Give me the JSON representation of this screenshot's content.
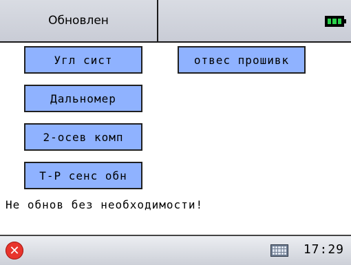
{
  "header": {
    "title": "Обновлен"
  },
  "buttons": {
    "angle_system": "Угл сист",
    "plumb_firmware": "отвес прошивк",
    "rangefinder": "Дальномер",
    "two_axis_comp": "2-осев комп",
    "tp_sensor_update": "T-P сенс обн"
  },
  "warning": "Не обнов без необходимости!",
  "taskbar": {
    "time": "17:29"
  },
  "icons": {
    "battery": "battery-full-icon",
    "close": "close-icon",
    "keyboard": "keyboard-icon"
  },
  "colors": {
    "button_bg": "#8fb2ff",
    "battery": "#2bd14b",
    "close": "#e8342c"
  }
}
